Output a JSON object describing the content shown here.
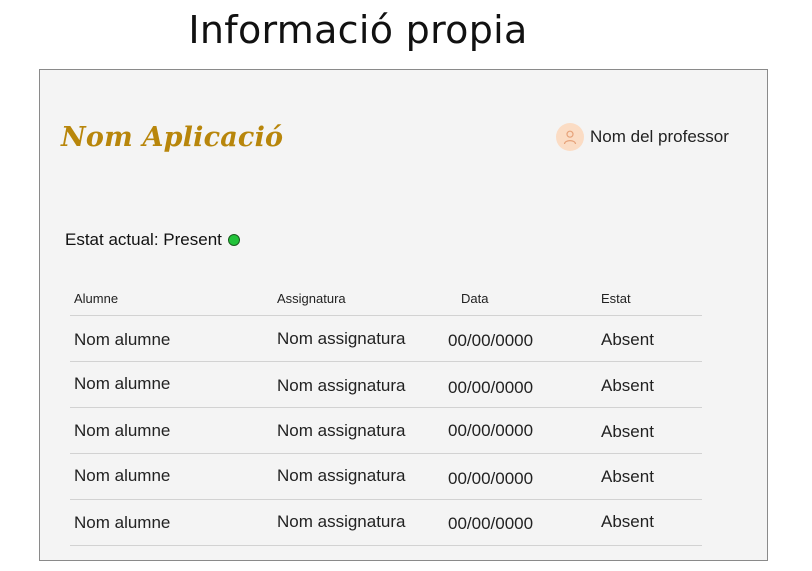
{
  "page_title": "Informació propia",
  "app": {
    "name": "Nom Aplicació"
  },
  "user": {
    "name": "Nom del professor",
    "avatar_icon": "user-icon"
  },
  "status": {
    "label": "Estat actual:",
    "value": "Present",
    "dot_color": "#22c33a"
  },
  "table": {
    "headers": [
      "Alumne",
      "Assignatura",
      "Data",
      "Estat"
    ],
    "rows": [
      [
        "Nom alumne",
        "Nom assignatura",
        "00/00/0000",
        "Absent"
      ],
      [
        "Nom alumne",
        "Nom assignatura",
        "00/00/0000",
        "Absent"
      ],
      [
        "Nom alumne",
        "Nom assignatura",
        "00/00/0000",
        "Absent"
      ],
      [
        "Nom alumne",
        "Nom assignatura",
        "00/00/0000",
        "Absent"
      ],
      [
        "Nom alumne",
        "Nom assignatura",
        "00/00/0000",
        "Absent"
      ]
    ]
  }
}
